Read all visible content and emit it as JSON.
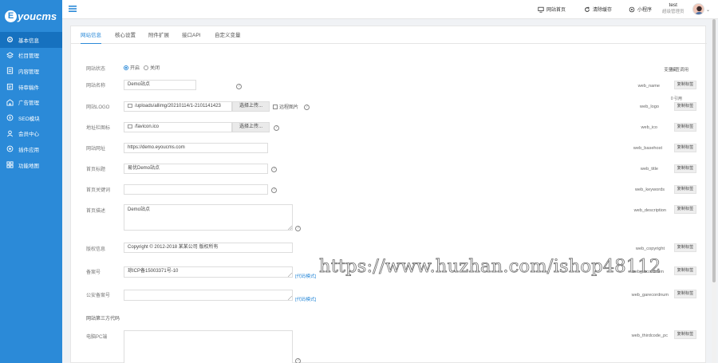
{
  "app": {
    "logo_letter": "E",
    "logo_text": "youcms"
  },
  "sidebar": {
    "items": [
      {
        "label": "基本信息",
        "icon": "gear-icon"
      },
      {
        "label": "栏目管理",
        "icon": "layers-icon"
      },
      {
        "label": "内容管理",
        "icon": "document-icon"
      },
      {
        "label": "待审稿件",
        "icon": "clipboard-icon"
      },
      {
        "label": "广告管理",
        "icon": "building-icon"
      },
      {
        "label": "SEO模块",
        "icon": "compass-icon"
      },
      {
        "label": "会员中心",
        "icon": "user-icon"
      },
      {
        "label": "插件应用",
        "icon": "puzzle-icon"
      },
      {
        "label": "功能地图",
        "icon": "grid-icon"
      }
    ]
  },
  "topbar": {
    "site_home": "网站首页",
    "clear_cache": "清除缓存",
    "mini_program": "小程序",
    "username": "test",
    "role": "超级管理员"
  },
  "tabs": [
    "网站信息",
    "核心设置",
    "附件扩展",
    "接口API",
    "自定义变量"
  ],
  "header": {
    "var_name": "变量名",
    "tag_call": "标签调用"
  },
  "copy_label": "复制标签",
  "upload_label": "选择上传...",
  "code_mode": "[代码模式]",
  "form": {
    "site_status": {
      "label": "网站状态",
      "on": "开启",
      "off": "关闭"
    },
    "web_name": {
      "label": "网站名称",
      "value": "Demo站点",
      "var": "web_name"
    },
    "web_logo": {
      "label": "网站LOGO",
      "value": "/uploads/allimg/20210114/1-2101141423",
      "remote": "远程图片",
      "var": "web_logo",
      "hint": "0 引用"
    },
    "web_ico": {
      "label": "地址栏图标",
      "value": "/favicon.ico",
      "var": "web_ico"
    },
    "web_basehost": {
      "label": "网站网址",
      "value": "https://demo.eyoucms.com",
      "var": "web_basehost"
    },
    "web_title": {
      "label": "首页标题",
      "value": "易优Demo站点",
      "var": "web_title"
    },
    "web_keywords": {
      "label": "首页关键词",
      "value": "",
      "var": "web_keywords"
    },
    "web_description": {
      "label": "首页描述",
      "value": "Demo站点",
      "var": "web_description"
    },
    "web_copyright": {
      "label": "版权信息",
      "value": "Copyright © 2012-2018 某某公司 版权所有",
      "var": "web_copyright"
    },
    "web_recordnum": {
      "label": "备案号",
      "value": "琼ICP备15003371号-10",
      "var": "web_recordnum"
    },
    "web_garecordnum": {
      "label": "公安备案号",
      "value": "",
      "var": "web_garecordnum"
    },
    "third_section": "网站第三方代码",
    "web_thirdcode_pc": {
      "label": "电脑PC端",
      "value": "",
      "var": "web_thirdcode_pc"
    }
  },
  "watermark": "https://www.huzhan.com/ishop48112",
  "colors": {
    "sidebar": "#2b8ad8",
    "sidebar_active": "#1671bf",
    "link": "#2b8ad8"
  }
}
